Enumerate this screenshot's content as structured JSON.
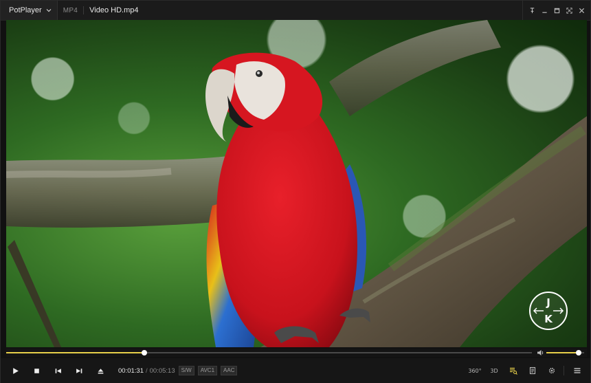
{
  "titlebar": {
    "app_name": "PotPlayer",
    "format": "MP4",
    "title": "Video HD.mp4"
  },
  "icons": {
    "app_menu": "chevron-down-icon",
    "pin": "pin-icon",
    "minimize": "minimize-icon",
    "maximize": "maximize-icon",
    "fullscreen": "fullscreen-icon",
    "close": "close-icon",
    "volume": "speaker-icon",
    "play": "play-icon",
    "stop": "stop-icon",
    "previous": "previous-track-icon",
    "next": "next-track-icon",
    "eject": "eject-icon",
    "playlist": "playlist-icon",
    "chapters": "chapter-icon",
    "settings": "gear-icon",
    "menu": "hamburger-menu-icon"
  },
  "watermark": {
    "line1": "J",
    "line2": "K"
  },
  "playback": {
    "position": 0.263,
    "volume": 0.85,
    "current_time": "00:01:31",
    "separator": "/",
    "total_time": "00:05:13"
  },
  "tags": {
    "sw": "S/W",
    "video_codec": "AVC1",
    "audio_codec": "AAC"
  },
  "right_controls": {
    "vr": "360°",
    "three_d": "3D"
  },
  "colors": {
    "accent": "#e8d04a",
    "background": "#161616",
    "text": "#e8e8e8"
  }
}
